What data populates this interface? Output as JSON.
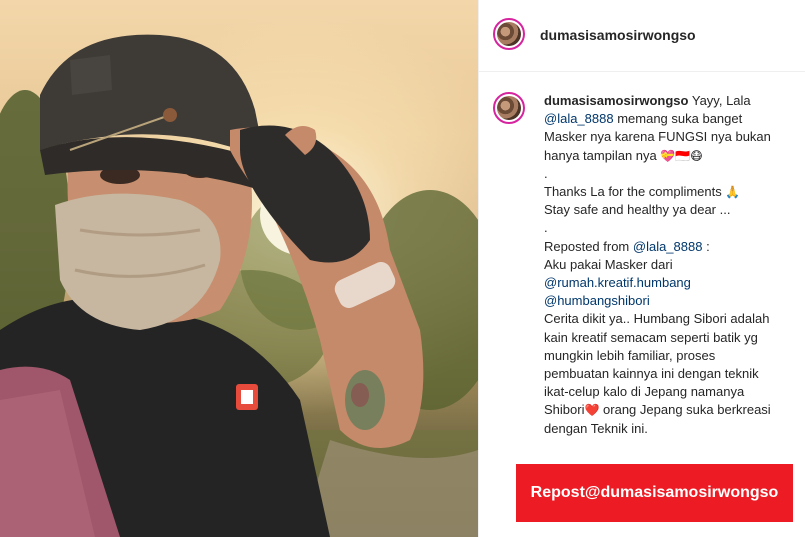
{
  "post": {
    "username": "dumasisamosirwongso",
    "photo_alt": "selfie"
  },
  "caption": {
    "username": "dumasisamosirwongso",
    "lines": [
      {
        "pre": "Yayy, Lala",
        "mention": "",
        "post": ""
      },
      {
        "pre": "",
        "mention": "@lala_8888",
        "post": " memang suka banget"
      },
      {
        "pre": "Masker nya karena FUNGSI nya bukan",
        "mention": "",
        "post": ""
      },
      {
        "pre": "hanya tampilan nya ",
        "mention": "",
        "post": "",
        "emoji": "💝🇮🇩😷"
      },
      {
        "pre": ".",
        "mention": "",
        "post": ""
      },
      {
        "pre": "Thanks La for the compliments ",
        "mention": "",
        "post": "",
        "emoji": "🙏"
      },
      {
        "pre": "Stay safe and healthy ya dear ...",
        "mention": "",
        "post": ""
      },
      {
        "pre": ".",
        "mention": "",
        "post": ""
      },
      {
        "pre": "Reposted from ",
        "mention": "@lala_8888",
        "post": " :"
      },
      {
        "pre": "Aku pakai Masker dari",
        "mention": "",
        "post": ""
      },
      {
        "pre": "",
        "mention": "@rumah.kreatif.humbang",
        "post": ""
      },
      {
        "pre": "",
        "mention": "@humbangshibori",
        "post": ""
      },
      {
        "pre": "Cerita dikit ya.. Humbang Sibori adalah",
        "mention": "",
        "post": ""
      },
      {
        "pre": "kain kreatif semacam seperti batik yg",
        "mention": "",
        "post": ""
      },
      {
        "pre": "mungkin lebih familiar, proses",
        "mention": "",
        "post": ""
      },
      {
        "pre": "pembuatan kainnya ini dengan teknik",
        "mention": "",
        "post": ""
      },
      {
        "pre": "ikat-celup kalo di Jepang namanya",
        "mention": "",
        "post": ""
      },
      {
        "pre": "Shibori",
        "mention": "",
        "post": " orang Jepang suka berkreasi",
        "emoji_mid": "❤️"
      },
      {
        "pre": "dengan Teknik ini.",
        "mention": "",
        "post": ""
      }
    ]
  },
  "repost_button": {
    "label": "Repost@dumasisamosirwongso",
    "color": "#ed1c24"
  },
  "colors": {
    "mention": "#00376b",
    "avatar_ring": "#d6249f"
  }
}
